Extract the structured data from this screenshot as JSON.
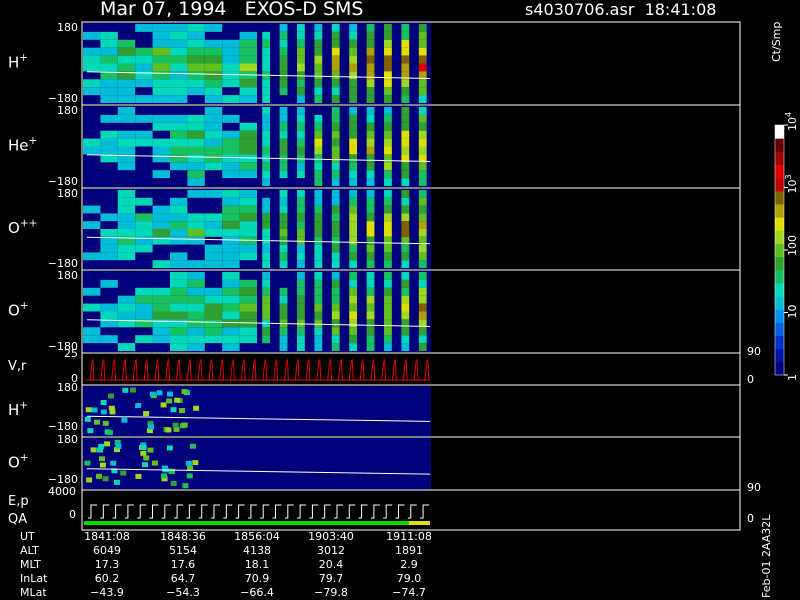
{
  "header": {
    "title": "Mar 07, 1994   EXOS-D SMS",
    "file_time": "s4030706.asr  18:41:08"
  },
  "colorbar": {
    "unit": "Ct/Smp",
    "ticks": [
      {
        "label": "1",
        "value": 1
      },
      {
        "label": "10",
        "value": 10
      },
      {
        "label": "100",
        "value": 100
      },
      {
        "label": "10",
        "sup": "3",
        "value": 1000
      },
      {
        "label": "10",
        "sup": "4",
        "value": 10000
      }
    ],
    "colors": [
      "#00007a",
      "#0010a0",
      "#0030c8",
      "#0060e0",
      "#0090f0",
      "#00bcd4",
      "#00d8b8",
      "#18c060",
      "#30a030",
      "#60c020",
      "#a0d820",
      "#e0e000",
      "#b0a000",
      "#806000",
      "#c00000",
      "#e00000",
      "#a00000",
      "#600000",
      "#ffffff"
    ]
  },
  "footer_id": "Feb-01 2AA32L",
  "chart_data": {
    "type": "heatmap",
    "panels": [
      {
        "name": "H",
        "sup": "+",
        "ytop": "180",
        "ybottom": "−180",
        "intensity": [
          3,
          4,
          4,
          3,
          5,
          4,
          5,
          4,
          3,
          5,
          4,
          6,
          7,
          7,
          8,
          8,
          9,
          9,
          9,
          10
        ]
      },
      {
        "name": "He",
        "sup": "+",
        "ytop": "180",
        "ybottom": "−180",
        "intensity": [
          2,
          2,
          3,
          2,
          3,
          3,
          4,
          3,
          3,
          4,
          4,
          5,
          5,
          6,
          6,
          7,
          7,
          8,
          8,
          8
        ]
      },
      {
        "name": "O",
        "sup": "++",
        "ytop": "180",
        "ybottom": "−180",
        "intensity": [
          2,
          2,
          3,
          3,
          3,
          3,
          4,
          3,
          4,
          4,
          4,
          5,
          5,
          6,
          6,
          7,
          7,
          7,
          8,
          8
        ]
      },
      {
        "name": "O",
        "sup": "+",
        "ytop": "180",
        "ybottom": "−180",
        "intensity": [
          2,
          2,
          3,
          3,
          4,
          4,
          4,
          4,
          4,
          5,
          5,
          5,
          6,
          6,
          6,
          7,
          7,
          7,
          7,
          8
        ]
      }
    ],
    "vr_panel": {
      "name": "V,r",
      "ytop": "25",
      "ybottom": "0",
      "right_top": "90",
      "right_bottom": "0"
    },
    "low_panels": [
      {
        "name": "H",
        "sup": "+",
        "ytop": "180",
        "ybottom": "−180"
      },
      {
        "name": "O",
        "sup": "+",
        "ytop": "180",
        "ybottom": "−180"
      }
    ],
    "ep_panel": {
      "name": "E,p",
      "name2": "QA",
      "ytop": "4000",
      "ybottom": "0",
      "right_top": "90",
      "right_bottom": "0"
    },
    "ut_columns": [
      "1841:08",
      "1848:36",
      "1856:04",
      "1903:40",
      "1911:08"
    ],
    "rows": [
      {
        "label": "UT",
        "values": [
          "1841:08",
          "1848:36",
          "1856:04",
          "1903:40",
          "1911:08"
        ]
      },
      {
        "label": "ALT",
        "values": [
          "6049",
          "5154",
          "4138",
          "3012",
          "1891"
        ]
      },
      {
        "label": "MLT",
        "values": [
          "17.3",
          "17.6",
          "18.1",
          "20.4",
          "2.9"
        ]
      },
      {
        "label": "InLat",
        "values": [
          "60.2",
          "64.7",
          "70.9",
          "79.7",
          "79.0"
        ]
      },
      {
        "label": "MLat",
        "values": [
          "−43.9",
          "−54.3",
          "−66.4",
          "−79.8",
          "−74.7"
        ]
      }
    ]
  }
}
